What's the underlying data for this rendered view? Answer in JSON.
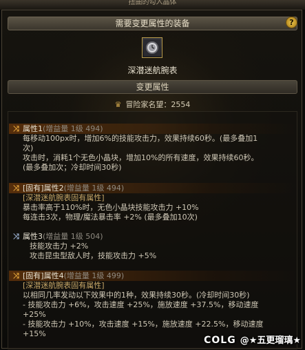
{
  "top_title": "扭曲的勾入晶体",
  "header": {
    "title": "需要变更属性的装备",
    "help_label": "?"
  },
  "item": {
    "name": "深潜迷航腕表",
    "icon": "watch-icon"
  },
  "change_section": {
    "title": "变更属性"
  },
  "adventurer": {
    "label": "冒险家名望：2554",
    "icon": "crest-icon"
  },
  "attributes": [
    {
      "prefix": "属性1",
      "tag": "(增益量 1级 494)",
      "icon": "shuffle-icon",
      "highlighted": true,
      "lines": [
        "每移动100px时，增加6%的技能攻击力，效果持续60秒。(最多叠加1",
        "次)",
        "攻击时，消耗1个无色小晶块，增加10%的所有速度，效果持续60秒。",
        "(最多叠加次；冷却时间30秒)"
      ]
    },
    {
      "prefix": "[固有]属性2",
      "tag": "(增益量 1级 494)",
      "icon": "shuffle-icon",
      "highlighted": true,
      "gold_line": "[深潜迷航腕表固有属性]",
      "lines": [
        "暴击率高于110%时，无色小晶块技能攻击力 +10%",
        "每连击3次，物理/魔法暴击率 +2% (最多叠加10次)"
      ]
    },
    {
      "prefix": "属性3",
      "tag": "(增益量 1级 504)",
      "icon": "shuffle-icon",
      "highlighted": false,
      "lines": [
        "技能攻击力 +2%",
        "攻击昆虫型敌人时，技能攻击力 +5%"
      ]
    },
    {
      "prefix": "[固有]属性4",
      "tag": "(增益量 1级 499)",
      "icon": "shuffle-icon",
      "highlighted": true,
      "gold_line": "[深潜迷航腕表固有属性]",
      "lines": [
        "以相同几率发动以下效果中的1种，效果持续30秒。(冷却时间30秒)",
        "- 技能攻击力 +6%，攻击速度 +25%，施放速度 +37.5%，移动速度",
        "+25%",
        "- 技能攻击力 +10%，攻击速度 +15%，施放速度 +22.5%，移动速度",
        "+15%"
      ]
    }
  ],
  "watermark": {
    "logo": "COLG",
    "text": "@★五更瑠璃★"
  },
  "colors": {
    "accent": "#e0a23a",
    "gold_text": "#c8a868",
    "background": "#0b0b09"
  }
}
